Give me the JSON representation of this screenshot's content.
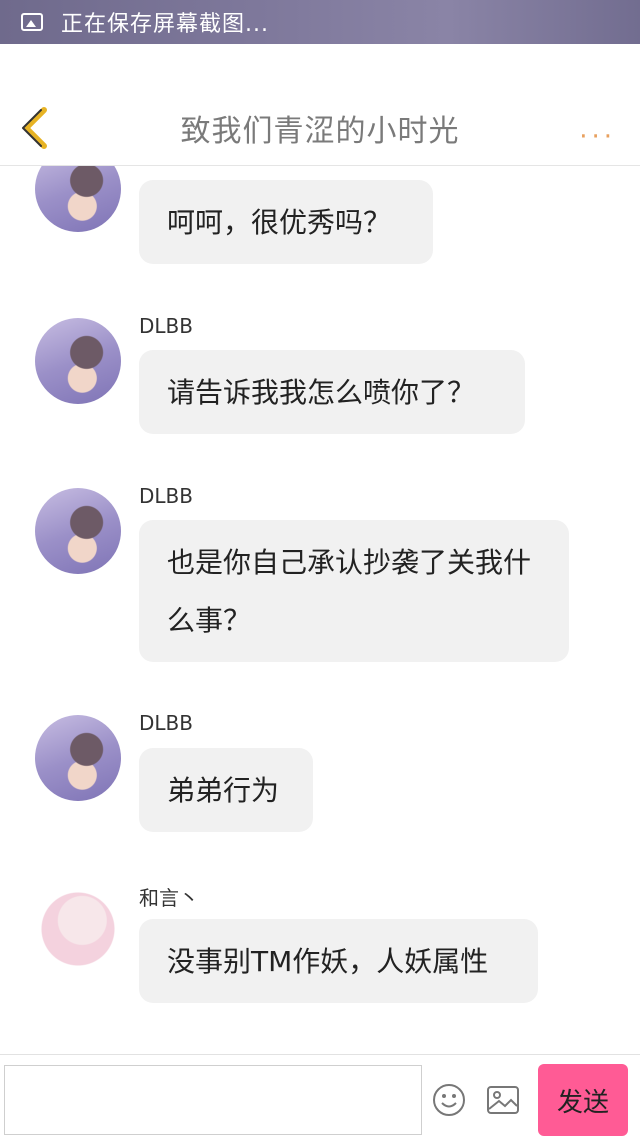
{
  "status_bar": {
    "text": "正在保存屏幕截图..."
  },
  "header": {
    "title": "致我们青涩的小时光",
    "more": "···"
  },
  "messages": [
    {
      "sender": "",
      "text": "呵呵，很优秀吗？"
    },
    {
      "sender": "DLBB",
      "text": "请告诉我我怎么喷你了？"
    },
    {
      "sender": "DLBB",
      "text": "也是你自己承认抄袭了关我什么事？"
    },
    {
      "sender": "DLBB",
      "text": "弟弟行为"
    },
    {
      "sender": "和言丶",
      "text": "没事别TM作妖，人妖属性"
    }
  ],
  "input_bar": {
    "send_label": "发送",
    "input_value": ""
  },
  "colors": {
    "accent": "#ff5b95",
    "back_arrow": "#e7b324",
    "more_dots": "#e8a05e"
  },
  "icons": [
    "image-icon",
    "back-arrow-icon",
    "more-icon",
    "emoji-icon",
    "picture-icon"
  ]
}
